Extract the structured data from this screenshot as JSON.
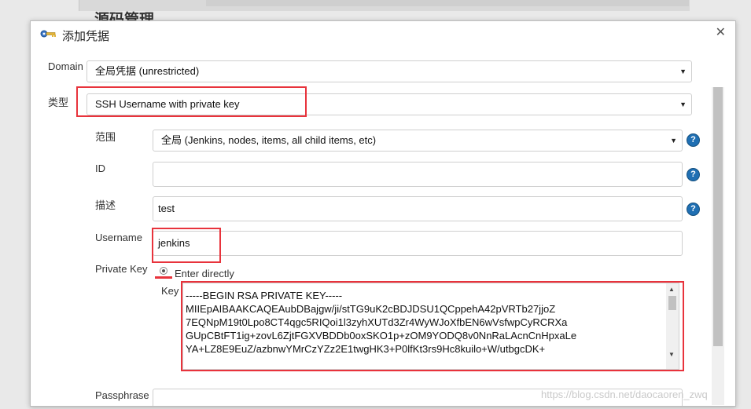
{
  "background": {
    "heading": "源码管理"
  },
  "dialog": {
    "title": "添加凭据",
    "close_icon": "close-icon",
    "title_icon": "key-icon"
  },
  "form": {
    "domain": {
      "label": "Domain",
      "value": "全局凭据 (unrestricted)"
    },
    "type": {
      "label": "类型",
      "value": "SSH Username with private key"
    },
    "scope": {
      "label": "范围",
      "value": "全局 (Jenkins, nodes, items, all child items, etc)"
    },
    "id": {
      "label": "ID",
      "value": ""
    },
    "description": {
      "label": "描述",
      "value": "test"
    },
    "username": {
      "label": "Username",
      "value": "jenkins"
    },
    "private_key": {
      "label": "Private Key",
      "option_label": "Enter directly",
      "key_label": "Key",
      "key_lines": [
        "-----BEGIN RSA PRIVATE KEY-----",
        "MIIEpAIBAAKCAQEAubDBajgw/ji/stTG9uK2cBDJDSU1QCppehA42pVRTb27jjoZ",
        "7EQNpM19t0Lpo8CT4qgc5RIQoi1l3zyhXUTd3Zr4WyWJoXfbEN6wVsfwpCyRCRXa",
        "GUpCBtFT1ig+zovL6ZjtFGXVBDDb0oxSKO1p+zOM9YODQ8v0NnRaLAcnCnHpxaLe",
        "YA+LZ8E9EuZ/azbnwYMrCzYZz2E1twgHK3+P0lfKt3rs9Hc8kuilo+W/utbgcDK+"
      ]
    },
    "passphrase": {
      "label": "Passphrase",
      "value": ""
    }
  },
  "help_icon": "?",
  "watermark": "https://blog.csdn.net/daocaoren_zwq",
  "colors": {
    "highlight": "#e8333c",
    "help": "#1f6fb3"
  }
}
